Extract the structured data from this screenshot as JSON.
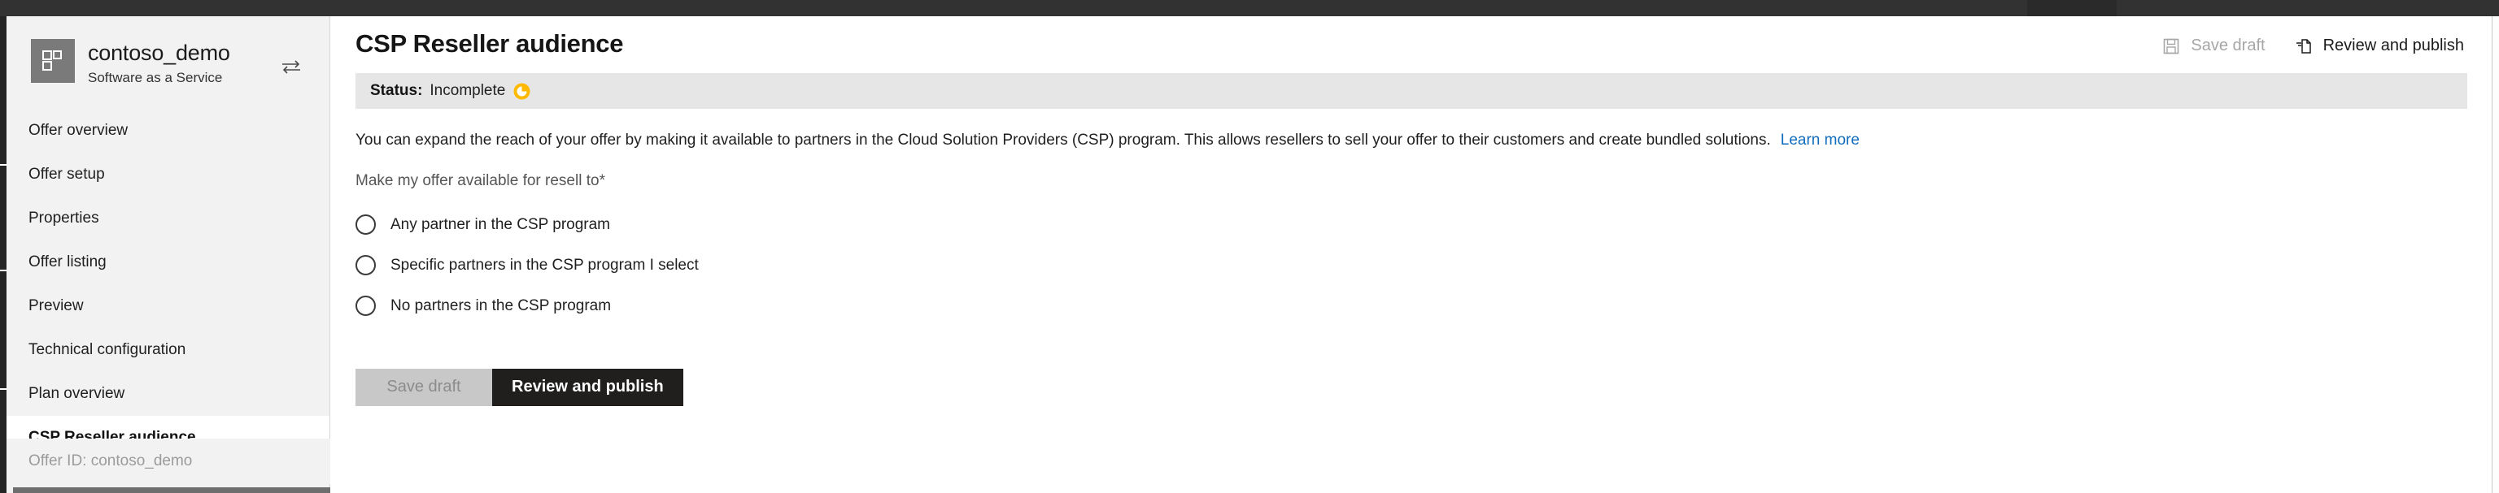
{
  "chrome": {
    "top_bar_color": "#323232"
  },
  "sidebar": {
    "offer": {
      "name": "contoso_demo",
      "subtitle": "Software as a Service",
      "logo_icon": "grid-tile-icon",
      "switch_icon": "switch-offer-icon"
    },
    "items": [
      {
        "label": "Offer overview",
        "active": false
      },
      {
        "label": "Offer setup",
        "active": false
      },
      {
        "label": "Properties",
        "active": false
      },
      {
        "label": "Offer listing",
        "active": false
      },
      {
        "label": "Preview",
        "active": false
      },
      {
        "label": "Technical configuration",
        "active": false
      },
      {
        "label": "Plan overview",
        "active": false
      },
      {
        "label": "CSP Reseller audience",
        "active": true
      }
    ],
    "offer_id": "Offer ID: contoso_demo"
  },
  "header": {
    "title": "CSP Reseller audience",
    "actions": [
      {
        "label": "Save draft",
        "icon": "save-disk-icon",
        "enabled": false
      },
      {
        "label": "Review and publish",
        "icon": "publish-page-icon",
        "enabled": true
      }
    ]
  },
  "status": {
    "label": "Status:",
    "value": "Incomplete",
    "icon": "incomplete-pie-icon",
    "icon_color": "#ffb900",
    "background": "#e6e6e6"
  },
  "content": {
    "description": "You can expand the reach of your offer by making it available to partners in the Cloud Solution Providers (CSP) program. This allows resellers to sell your offer to their customers and create bundled solutions.",
    "learn_more": "Learn more",
    "learn_more_color": "#0f6cbd",
    "field_label": "Make my offer available for resell to",
    "required_marker": "*",
    "radio_options": [
      {
        "label": "Any partner in the CSP program",
        "selected": false
      },
      {
        "label": "Specific partners in the CSP program I select",
        "selected": false
      },
      {
        "label": "No partners in the CSP program",
        "selected": false
      }
    ]
  },
  "footer": {
    "save_draft": "Save draft",
    "review_publish": "Review and publish",
    "primary_color": "#201f1e",
    "secondary_color": "#c8c8c8"
  }
}
